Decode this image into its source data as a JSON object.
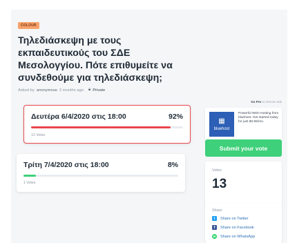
{
  "poll": {
    "tag": "COLOUR",
    "title": "Τηλεδιάσκεψη με τους εκπαιδευτικούς του ΣΔΕ Μεσολογγίου. Πότε επιθυμείτε να συνδεθούμε για τηλεδιάσκεψη;",
    "meta": {
      "asked_by_prefix": "Asked by",
      "author": "anonymous",
      "time": "2 months ago",
      "privacy": "Private"
    },
    "options": [
      {
        "label": "Δευτέρα 6/4/2020 στις 18:00",
        "percent_text": "92%",
        "fraction": 0.92,
        "votes_text": "12 Votes",
        "bar_color": "#e8474c",
        "selected": true
      },
      {
        "label": "Τρίτη 7/4/2020 στις 18:00",
        "percent_text": "8%",
        "fraction": 0.08,
        "votes_text": "1 Votes",
        "bar_color": "#3ed07a",
        "selected": false
      }
    ]
  },
  "sidebar": {
    "go_pro": "Go Pro",
    "go_pro_suffix": " to remove ads",
    "ad": {
      "brand": "bluehost",
      "icon": "grid-icon",
      "text": "Powerful Web Hosting from bluehost. Get started today for just $3.95/mo."
    },
    "submit_label": "Submit your vote",
    "votes_label": "Votes",
    "votes_count": "13",
    "share_label": "Share",
    "share_items": [
      {
        "label": "Share on Twitter",
        "icon": "twitter-icon",
        "color": "#1da1f2"
      },
      {
        "label": "Share on Facebook",
        "icon": "facebook-icon",
        "color": "#3b5998"
      },
      {
        "label": "Share on WhatsApp",
        "icon": "whatsapp-icon",
        "color": "#25d366"
      }
    ]
  }
}
